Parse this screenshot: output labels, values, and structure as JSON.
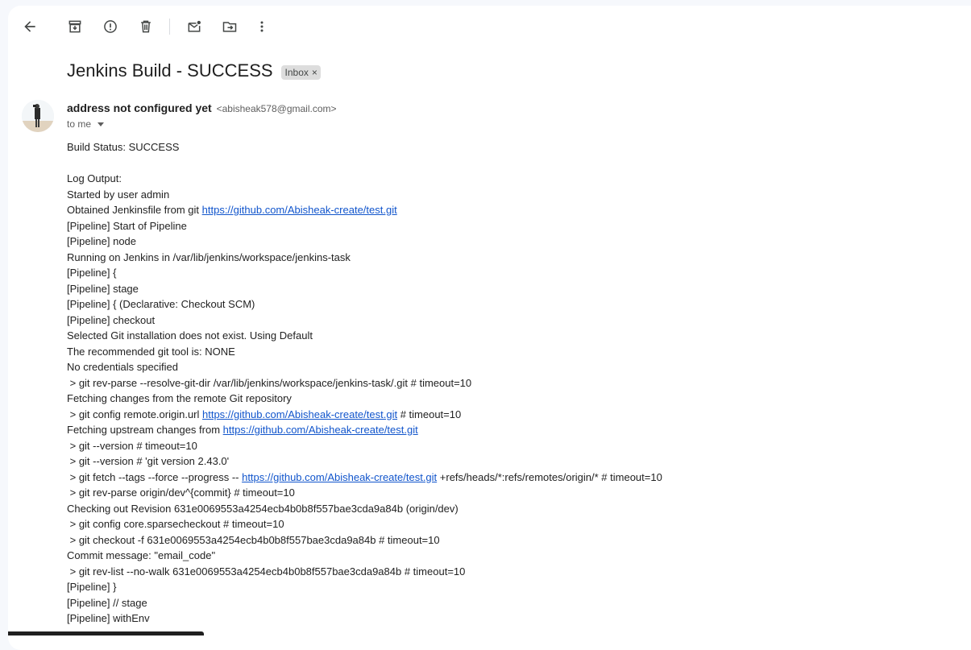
{
  "toolbar": {
    "buttons": [
      {
        "name": "back-icon"
      },
      {
        "name": "archive-icon"
      },
      {
        "name": "report-spam-icon"
      },
      {
        "name": "delete-icon"
      },
      {
        "name": "mark-unread-icon"
      },
      {
        "name": "move-to-icon"
      },
      {
        "name": "more-options-icon"
      }
    ]
  },
  "email": {
    "subject": "Jenkins Build - SUCCESS",
    "label": "Inbox",
    "label_remove": "×",
    "sender_name": "address not configured yet",
    "sender_email": "<abisheak578@gmail.com>",
    "recipient": "to me"
  },
  "body": {
    "lines": [
      {
        "text": "Build Status: SUCCESS"
      },
      {
        "text": ""
      },
      {
        "text": "Log Output:"
      },
      {
        "text": "Started by user admin"
      },
      {
        "pre": "Obtained Jenkinsfile from git ",
        "link": "https://github.com/Abisheak-create/test.git",
        "post": ""
      },
      {
        "text": "[Pipeline] Start of Pipeline"
      },
      {
        "text": "[Pipeline] node"
      },
      {
        "text": "Running on Jenkins in /var/lib/jenkins/workspace/jenkins-task"
      },
      {
        "text": "[Pipeline] {"
      },
      {
        "text": "[Pipeline] stage"
      },
      {
        "text": "[Pipeline] { (Declarative: Checkout SCM)"
      },
      {
        "text": "[Pipeline] checkout"
      },
      {
        "text": "Selected Git installation does not exist. Using Default"
      },
      {
        "text": "The recommended git tool is: NONE"
      },
      {
        "text": "No credentials specified"
      },
      {
        "text": " > git rev-parse --resolve-git-dir /var/lib/jenkins/workspace/jenkins-task/.git # timeout=10"
      },
      {
        "text": "Fetching changes from the remote Git repository"
      },
      {
        "pre": " > git config remote.origin.url ",
        "link": "https://github.com/Abisheak-create/test.git",
        "post": " # timeout=10"
      },
      {
        "pre": "Fetching upstream changes from ",
        "link": "https://github.com/Abisheak-create/test.git",
        "post": ""
      },
      {
        "text": " > git --version # timeout=10"
      },
      {
        "text": " > git --version # 'git version 2.43.0'"
      },
      {
        "pre": " > git fetch --tags --force --progress -- ",
        "link": "https://github.com/Abisheak-create/test.git",
        "post": " +refs/heads/*:refs/remotes/origin/* # timeout=10"
      },
      {
        "text": " > git rev-parse origin/dev^{commit} # timeout=10"
      },
      {
        "text": "Checking out Revision 631e0069553a4254ecb4b0b8f557bae3cda9a84b (origin/dev)"
      },
      {
        "text": " > git config core.sparsecheckout # timeout=10"
      },
      {
        "text": " > git checkout -f 631e0069553a4254ecb4b0b8f557bae3cda9a84b # timeout=10"
      },
      {
        "text": "Commit message: \"email_code\""
      },
      {
        "text": " > git rev-list --no-walk 631e0069553a4254ecb4b0b8f557bae3cda9a84b # timeout=10"
      },
      {
        "text": "[Pipeline] }"
      },
      {
        "text": "[Pipeline] // stage"
      },
      {
        "text": "[Pipeline] withEnv"
      }
    ]
  },
  "colors": {
    "link": "#1155cc",
    "chip_bg": "#dddddd",
    "page_bg": "#f6f8fc"
  }
}
